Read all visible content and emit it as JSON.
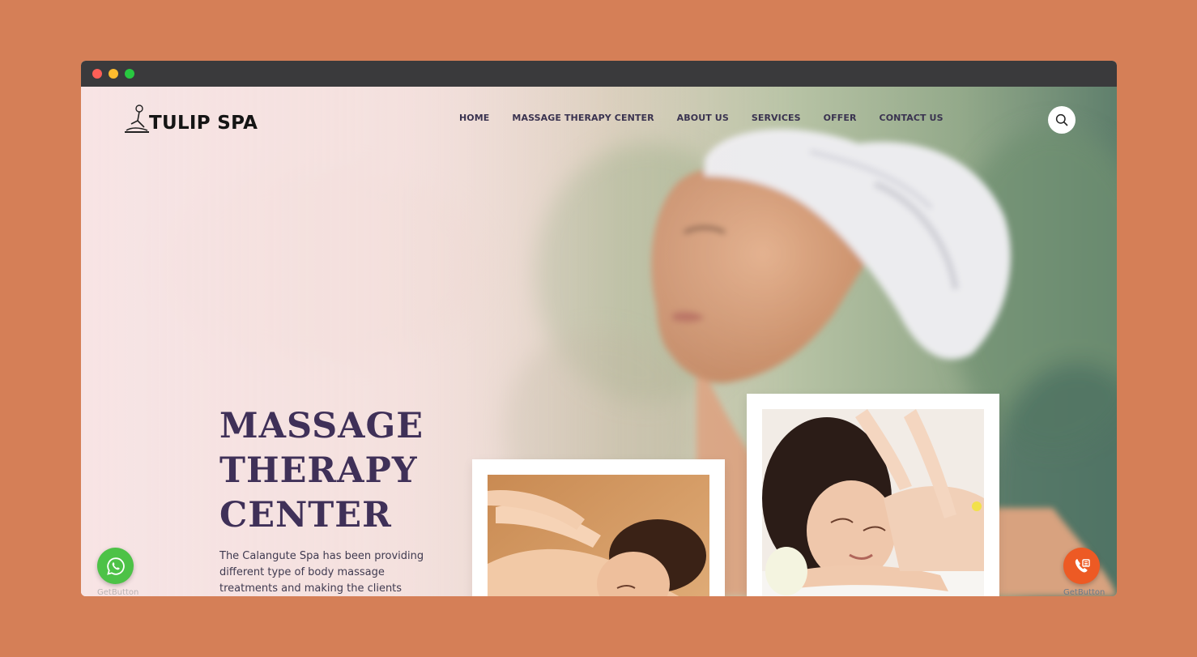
{
  "brand": {
    "name": "TULIP SPA"
  },
  "nav": {
    "items": [
      {
        "label": "HOME"
      },
      {
        "label": "MASSAGE THERAPY CENTER"
      },
      {
        "label": "ABOUT US"
      },
      {
        "label": "SERVICES"
      },
      {
        "label": "OFFER"
      },
      {
        "label": "CONTACT US"
      }
    ]
  },
  "hero": {
    "title": "MASSAGE THERAPY CENTER",
    "description": "The Calangute Spa has been providing different type of body massage treatments and making the clients happy"
  },
  "floating": {
    "whatsapp_label": "GetButton",
    "call_label": "GetButton"
  },
  "icons": {
    "search": "search-icon",
    "whatsapp": "whatsapp-icon",
    "phone": "phone-icon",
    "logo": "massage-logo-icon"
  },
  "colors": {
    "background": "#d57f57",
    "titlebar": "#3a3a3c",
    "nav_text": "#3a3350",
    "hero_title": "#3f3058",
    "whatsapp": "#4dc247",
    "call": "#ed5a24"
  }
}
